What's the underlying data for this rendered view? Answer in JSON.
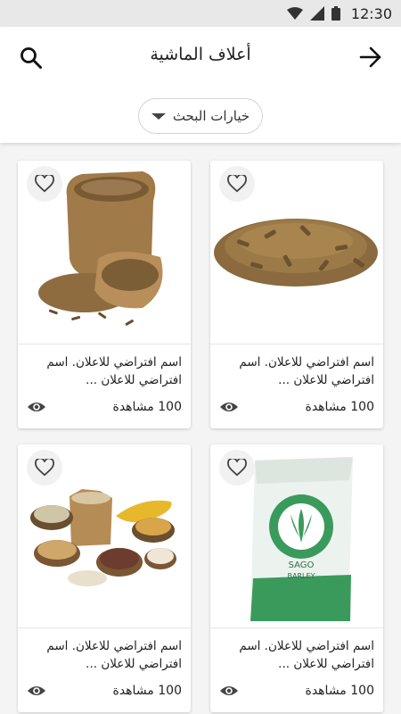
{
  "status_bar": {
    "time": "12:30"
  },
  "header": {
    "title": "أعلاف الماشية"
  },
  "filter": {
    "label": "خيارات البحث"
  },
  "products": [
    {
      "image": "pellets-pile",
      "description": "اسم افتراضي للاعلان. اسم افتراضي للاعلان ...",
      "views": "100 مشاهدة"
    },
    {
      "image": "feed-sack-bowl",
      "description": "اسم افتراضي للاعلان. اسم افتراضي للاعلان ...",
      "views": "100 مشاهدة"
    },
    {
      "image": "barley-sack",
      "description": "اسم افتراضي للاعلان. اسم افتراضي للاعلان ...",
      "views": "100 مشاهدة",
      "image_label": "SAGO BARLEY"
    },
    {
      "image": "grain-bowls",
      "description": "اسم افتراضي للاعلان. اسم افتراضي للاعلان ...",
      "views": "100 مشاهدة"
    }
  ],
  "icons": {
    "back": "arrow-right-icon",
    "search": "search-icon",
    "favorite": "heart-outline-icon",
    "views": "eye-icon"
  }
}
